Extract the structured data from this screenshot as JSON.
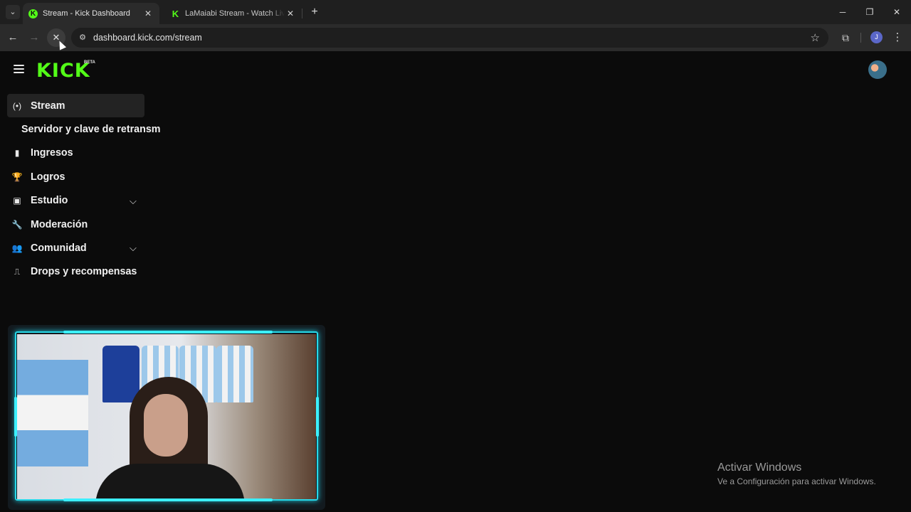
{
  "browser": {
    "tabs": [
      {
        "title": "Stream - Kick Dashboard",
        "active": true
      },
      {
        "title": "LaMaiabi Stream - Watch Live o",
        "active": false
      }
    ],
    "url": "dashboard.kick.com/stream",
    "profile_initial": "J"
  },
  "app": {
    "logo_text": "KICK",
    "beta_label": "BETA"
  },
  "sidebar": {
    "items": [
      {
        "label": "Stream",
        "icon": "broadcast-icon",
        "glyph": "(•)",
        "active": true
      },
      {
        "label": "Servidor y clave de retransm",
        "sub": true
      },
      {
        "label": "Ingresos",
        "icon": "chart-icon",
        "glyph": "▮"
      },
      {
        "label": "Logros",
        "icon": "trophy-icon",
        "glyph": "🏆"
      },
      {
        "label": "Estudio",
        "icon": "studio-icon",
        "glyph": "▣",
        "expandable": true
      },
      {
        "label": "Moderación",
        "icon": "wrench-icon",
        "glyph": "🔧"
      },
      {
        "label": "Comunidad",
        "icon": "community-icon",
        "glyph": "👥",
        "expandable": true
      },
      {
        "label": "Drops y recompensas",
        "icon": "drops-icon",
        "glyph": "⎍"
      }
    ]
  },
  "watermark": {
    "title": "Activar Windows",
    "subtitle": "Ve a Configuración para activar Windows."
  },
  "colors": {
    "accent": "#53fc18",
    "background": "#0b0b0b",
    "webcam_frame": "#26d8e8"
  }
}
